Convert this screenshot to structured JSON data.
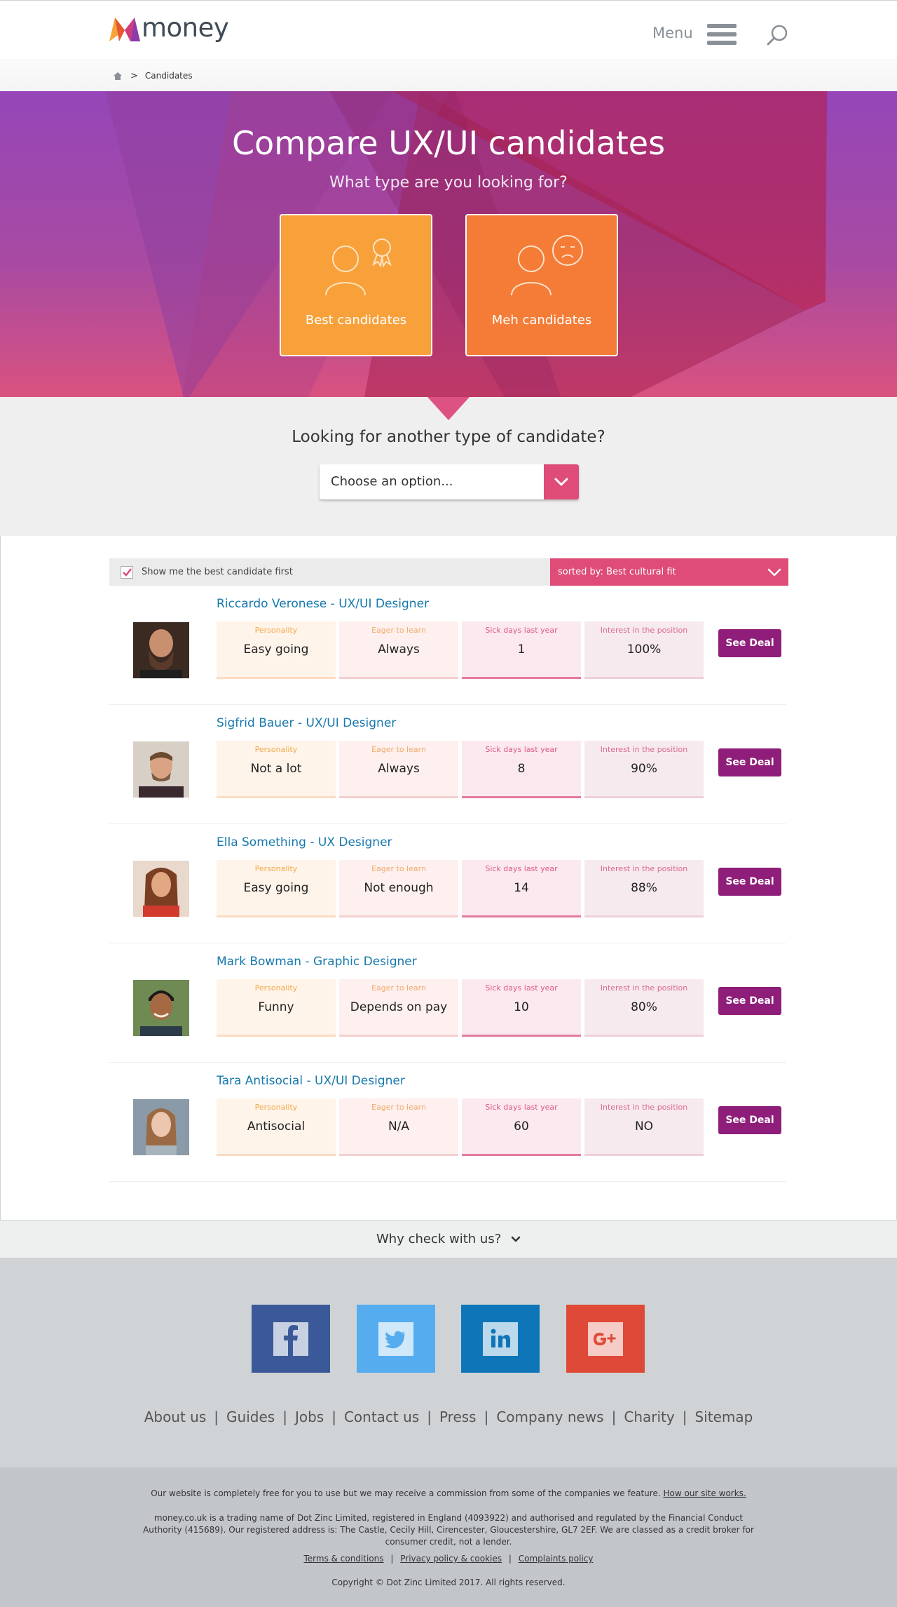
{
  "header": {
    "logo_text": "money",
    "menu_label": "Menu"
  },
  "breadcrumb": {
    "current": "Candidates"
  },
  "hero": {
    "title": "Compare UX/UI candidates",
    "subtitle": "What type are you looking for?",
    "options": [
      {
        "label": "Best candidates",
        "icon": "person-award-icon"
      },
      {
        "label": "Meh candidates",
        "icon": "person-unhappy-icon"
      }
    ]
  },
  "another": {
    "title": "Looking for another type of candidate?",
    "select_value": "Choose an option..."
  },
  "results": {
    "filter_label": "Show me the best candidate first",
    "filter_checked": true,
    "sort_label": "sorted by:  Best cultural fit",
    "stat_labels": [
      "Personality",
      "Eager to learn",
      "Sick days last year",
      "Interest in the position"
    ],
    "deal_label": "See Deal",
    "candidates": [
      {
        "name": "Riccardo Veronese - UX/UI Designer",
        "personality": "Easy going",
        "eager": "Always",
        "sick": "1",
        "interest": "100%"
      },
      {
        "name": "Sigfrid Bauer - UX/UI Designer",
        "personality": "Not a lot",
        "eager": "Always",
        "sick": "8",
        "interest": "90%"
      },
      {
        "name": "Ella Something - UX Designer",
        "personality": "Easy going",
        "eager": "Not enough",
        "sick": "14",
        "interest": "88%"
      },
      {
        "name": "Mark Bowman - Graphic Designer",
        "personality": "Funny",
        "eager": "Depends on pay",
        "sick": "10",
        "interest": "80%"
      },
      {
        "name": "Tara Antisocial - UX/UI Designer",
        "personality": "Antisocial",
        "eager": "N/A",
        "sick": "60",
        "interest": "NO"
      }
    ]
  },
  "why": {
    "label": "Why check with us?"
  },
  "footer": {
    "social": [
      "facebook-icon",
      "twitter-icon",
      "linkedin-icon",
      "google-plus-icon"
    ],
    "links": [
      "About us",
      "Guides",
      "Jobs",
      "Contact us",
      "Press",
      "Company news",
      "Charity",
      "Sitemap"
    ],
    "free_text": "Our website is completely free for you to use but we may receive a commission from some of the companies we feature.",
    "free_link": "How our site works.",
    "trading_text": "money.co.uk is a trading name of Dot Zinc Limited, registered in England (4093922) and authorised and regulated by the Financial Conduct Authority (415689). Our registered address is: The Castle, Cecily Hill, Cirencester, Gloucestershire, GL7 2EF. We are classed as a credit broker for consumer credit, not a lender.",
    "legal_links": [
      "Terms & conditions",
      "Privacy policy & cookies",
      "Complaints policy"
    ],
    "copyright": "Copyright © Dot Zinc Limited 2017. All rights reserved."
  },
  "colors": {
    "accent_pink": "#de4c77",
    "deal_purple": "#8e1e7a",
    "name_blue": "#1779ad",
    "best_orange": "#f8a13b",
    "meh_orange": "#f47c36"
  }
}
